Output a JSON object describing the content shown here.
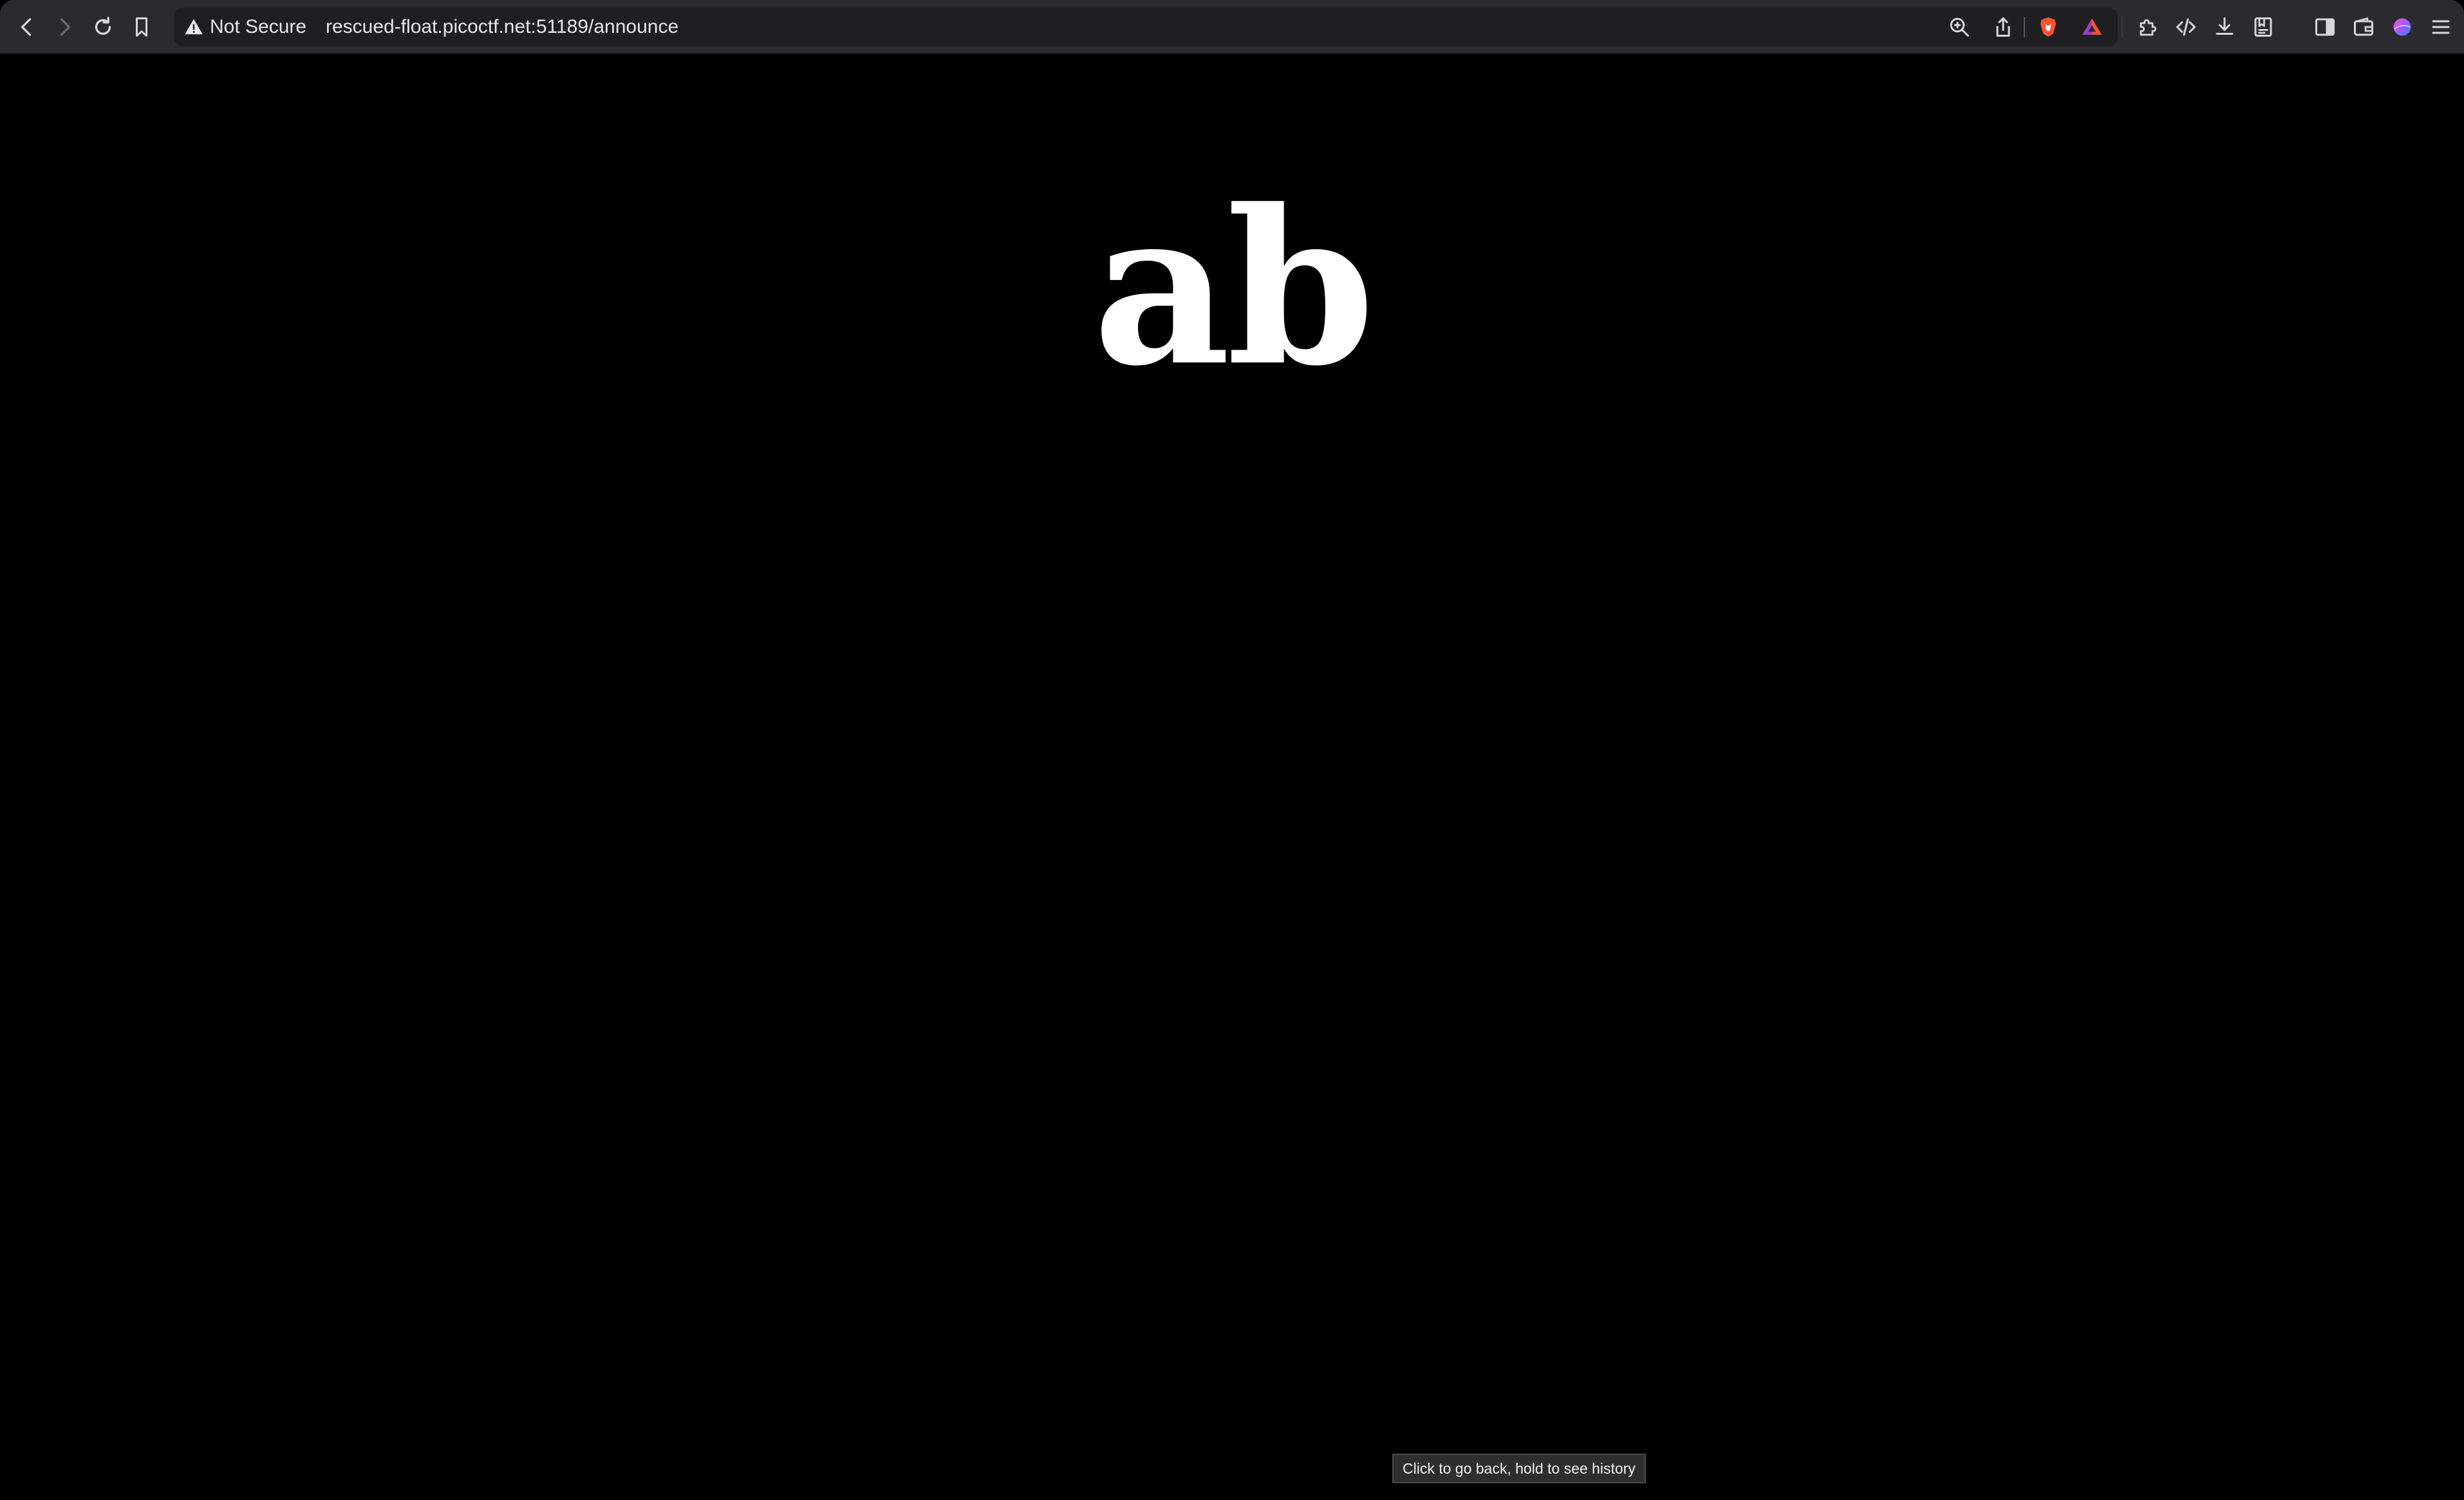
{
  "browser": {
    "security_label": "Not Secure",
    "url": "rescued-float.picoctf.net:51189/announce",
    "icons": {
      "back": "chevron-left-icon",
      "forward": "chevron-right-icon",
      "reload": "reload-icon",
      "bookmark": "bookmark-icon",
      "warning": "warning-triangle-icon",
      "zoom": "zoom-icon",
      "share": "share-icon",
      "brave_shields": "brave-lion-icon",
      "brave_rewards": "triangle-rewards-icon",
      "extensions": "puzzle-icon",
      "dev_tools": "code-icon",
      "downloads": "download-icon",
      "reading_list": "reading-list-icon",
      "sidebar": "sidebar-icon",
      "wallet": "wallet-icon",
      "profile": "profile-avatar-icon",
      "menu": "hamburger-menu-icon"
    },
    "colors": {
      "toolbar": "#2b2b2f",
      "urlbar": "#1f1f22",
      "brave_orange": "#fb542b"
    }
  },
  "page": {
    "heading": "ab",
    "background": "#000000",
    "text_color": "#ffffff"
  },
  "tooltip": {
    "text": "Click to go back, hold to see history"
  }
}
